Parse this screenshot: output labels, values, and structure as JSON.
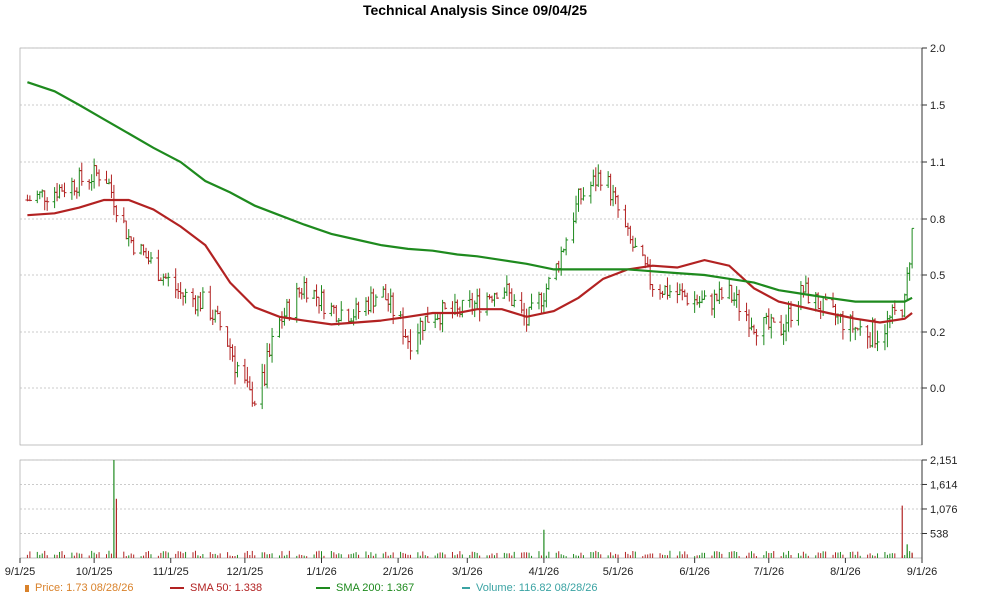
{
  "chart_data": {
    "type": "line",
    "title": "Technical Analysis Since 09/04/25",
    "xlabel": "",
    "ylabel": "",
    "x_ticks": [
      "9/1/25",
      "10/1/25",
      "11/1/25",
      "12/1/25",
      "1/1/26",
      "2/1/26",
      "3/1/26",
      "4/1/26",
      "5/1/26",
      "6/1/26",
      "7/1/26",
      "8/1/26",
      "9/1/26"
    ],
    "price_axis": {
      "ticks": [
        "2.0",
        "1.5",
        "1.1",
        "0.8",
        "0.5",
        "0.2",
        "0.0"
      ],
      "tick_values": [
        2.0,
        1.5,
        1.1,
        0.8,
        0.5,
        0.2,
        0.0
      ],
      "range": [
        -0.45,
        2.0
      ],
      "scale": "log-like"
    },
    "volume_axis": {
      "ticks": [
        "2,151",
        "1,614",
        "1,076",
        "538"
      ],
      "tick_values": [
        2151,
        1614,
        1076,
        538
      ],
      "range": [
        0,
        2151
      ]
    },
    "grid": true,
    "price_x": [
      "2025-09-04",
      "2025-09-15",
      "2025-09-25",
      "2025-10-05",
      "2025-10-15",
      "2025-10-25",
      "2025-11-05",
      "2025-11-15",
      "2025-11-25",
      "2025-12-05",
      "2025-12-15",
      "2025-12-25",
      "2026-01-05",
      "2026-01-15",
      "2026-01-25",
      "2026-02-05",
      "2026-02-15",
      "2026-02-25",
      "2026-03-05",
      "2026-03-15",
      "2026-03-25",
      "2026-04-05",
      "2026-04-15",
      "2026-04-25",
      "2026-05-05",
      "2026-05-15",
      "2026-05-25",
      "2026-06-05",
      "2026-06-15",
      "2026-06-25",
      "2026-07-05",
      "2026-07-15",
      "2026-07-25",
      "2026-08-05",
      "2026-08-15",
      "2026-08-25",
      "2026-08-28"
    ],
    "series": [
      {
        "name": "Price",
        "color": "#d9822b",
        "values": [
          0.9,
          0.95,
          1.0,
          1.05,
          0.7,
          0.55,
          0.4,
          0.35,
          0.15,
          -0.1,
          0.25,
          0.45,
          0.32,
          0.3,
          0.42,
          0.18,
          0.3,
          0.3,
          0.35,
          0.45,
          0.25,
          0.5,
          0.9,
          1.05,
          0.7,
          0.45,
          0.4,
          0.35,
          0.4,
          0.25,
          0.2,
          0.42,
          0.3,
          0.22,
          0.2,
          0.35,
          0.73
        ]
      },
      {
        "name": "SMA 50",
        "color": "#b22222",
        "values": [
          0.82,
          0.83,
          0.86,
          0.9,
          0.9,
          0.85,
          0.76,
          0.66,
          0.46,
          0.33,
          0.28,
          0.26,
          0.24,
          0.25,
          0.26,
          0.28,
          0.3,
          0.3,
          0.32,
          0.32,
          0.28,
          0.31,
          0.38,
          0.48,
          0.53,
          0.55,
          0.54,
          0.58,
          0.55,
          0.43,
          0.36,
          0.33,
          0.3,
          0.27,
          0.25,
          0.27,
          0.3
        ]
      },
      {
        "name": "SMA 200",
        "color": "#1e8a1e",
        "values": [
          1.7,
          1.62,
          1.5,
          1.4,
          1.3,
          1.2,
          1.1,
          1.0,
          0.94,
          0.87,
          0.82,
          0.77,
          0.72,
          0.69,
          0.66,
          0.64,
          0.63,
          0.61,
          0.6,
          0.58,
          0.56,
          0.53,
          0.53,
          0.53,
          0.53,
          0.52,
          0.51,
          0.5,
          0.48,
          0.46,
          0.42,
          0.4,
          0.38,
          0.36,
          0.36,
          0.36,
          0.38
        ]
      }
    ],
    "volume": {
      "name": "Volume",
      "color": "#1e8a1e",
      "x": [
        "2025-10-09",
        "2025-10-10",
        "2026-04-01",
        "2026-08-24",
        "2026-08-26",
        "2026-08-28"
      ],
      "values": [
        2151,
        1300,
        620,
        1150,
        300,
        117
      ]
    },
    "legend_placement": "bottom",
    "legend": [
      {
        "label": "Price: 1.73  08/28/26",
        "color": "#d9822b"
      },
      {
        "label": "SMA 50: 1.338",
        "color": "#b22222"
      },
      {
        "label": "SMA 200: 1.367",
        "color": "#1e8a1e"
      },
      {
        "label": "Volume: 116.82  08/28/26",
        "color": "#3aa3a3"
      }
    ]
  }
}
